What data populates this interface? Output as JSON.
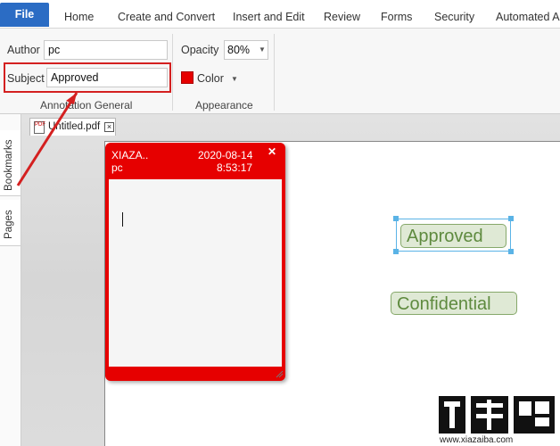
{
  "menu": {
    "file": "File",
    "tabs": [
      "Home",
      "Create and Convert",
      "Insert and Edit",
      "Review",
      "Forms",
      "Security",
      "Automated A"
    ]
  },
  "ribbon": {
    "annotation_general": {
      "author_label": "Author",
      "author_value": "pc",
      "subject_label": "Subject",
      "subject_value": "Approved",
      "title": "Annotation General"
    },
    "appearance": {
      "opacity_label": "Opacity",
      "opacity_value": "80%",
      "color_label": "Color",
      "color_value": "#e60000",
      "title": "Appearance"
    }
  },
  "side_panel": {
    "tabs": [
      "Bookmarks",
      "Pages"
    ]
  },
  "document": {
    "tab_name": "Untitled.pdf",
    "tab_icon": "pdf-icon"
  },
  "note_popup": {
    "author": "XIAZA..",
    "user": "pc",
    "date": "2020-08-14",
    "time": "8:53:17",
    "color": "#e60000"
  },
  "stamps": {
    "approved": "Approved",
    "confidential": "Confidential"
  },
  "watermark": {
    "logo_text": "下载吧",
    "url": "www.xiazaiba.com"
  },
  "colors": {
    "file_tab": "#2b6cc4",
    "highlight": "#d42020",
    "stamp_text": "#5e8a3e",
    "selection": "#5ab3e6"
  }
}
